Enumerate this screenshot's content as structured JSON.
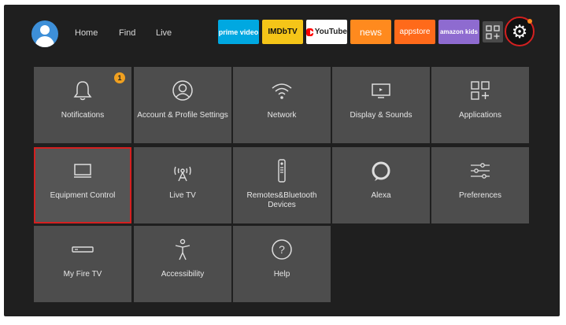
{
  "top_bar": {
    "nav": [
      "Home",
      "Find",
      "Live"
    ],
    "apps": [
      {
        "label": "prime video",
        "icon": "prime-video-logo",
        "color": "#00a8e1"
      },
      {
        "label": "IMDbTV",
        "icon": "imdb-tv-logo",
        "color": "#f5c518"
      },
      {
        "label": "YouTube",
        "icon": "youtube-logo",
        "color": "#ffffff"
      },
      {
        "label": "news",
        "icon": "news-logo",
        "color": "#ff8a1e"
      },
      {
        "label": "appstore",
        "icon": "appstore-logo",
        "color": "#ff6a1a"
      },
      {
        "label": "amazon kids",
        "icon": "amazon-kids-logo",
        "color": "#8e6bd0"
      }
    ],
    "app_grid_icon": "apps-grid-icon",
    "settings_icon": "gear-icon",
    "accent_color": "#d42020"
  },
  "settings": {
    "tiles": [
      {
        "label": "Notifications",
        "icon": "bell-icon",
        "badge": "1"
      },
      {
        "label": "Account & Profile Settings",
        "icon": "profile-icon"
      },
      {
        "label": "Network",
        "icon": "wifi-icon"
      },
      {
        "label": "Display & Sounds",
        "icon": "display-icon"
      },
      {
        "label": "Applications",
        "icon": "applications-icon"
      },
      {
        "label": "Equipment Control",
        "icon": "tv-icon",
        "selected": true
      },
      {
        "label": "Live TV",
        "icon": "antenna-icon"
      },
      {
        "label": "Remotes&Bluetooth Devices",
        "icon": "remote-icon"
      },
      {
        "label": "Alexa",
        "icon": "alexa-icon"
      },
      {
        "label": "Preferences",
        "icon": "sliders-icon"
      },
      {
        "label": "My Fire TV",
        "icon": "fire-tv-stick-icon"
      },
      {
        "label": "Accessibility",
        "icon": "accessibility-icon"
      },
      {
        "label": "Help",
        "icon": "help-icon"
      }
    ]
  }
}
